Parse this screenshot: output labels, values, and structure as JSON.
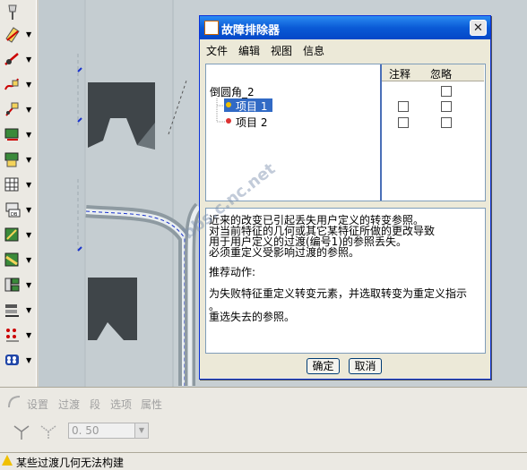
{
  "toolbar": {
    "tools": [
      {
        "icon": "pin-icon"
      },
      {
        "icon": "datum-plane-icon"
      },
      {
        "icon": "datum-axis-icon"
      },
      {
        "icon": "datum-curve-icon"
      },
      {
        "icon": "datum-point-icon"
      },
      {
        "icon": "coordinate-system-icon"
      },
      {
        "icon": "sketch-icon"
      },
      {
        "icon": "grid-icon"
      },
      {
        "icon": "database-icon"
      },
      {
        "icon": "extrude-icon"
      },
      {
        "icon": "revolve-icon"
      },
      {
        "icon": "sweep-icon"
      },
      {
        "icon": "blend-icon"
      },
      {
        "icon": "round-icon"
      },
      {
        "icon": "pattern-icon"
      }
    ]
  },
  "dialog": {
    "title": "故障排除器",
    "close_glyph": "✕",
    "menu": [
      "文件",
      "编辑",
      "视图",
      "信息"
    ],
    "columns": {
      "note": "注释",
      "ignore": "忽略"
    },
    "tree": {
      "root": "倒圆角_2",
      "items": [
        {
          "label": "项目 1",
          "selected": true
        },
        {
          "label": "项目 2",
          "selected": false
        }
      ]
    },
    "message": {
      "lines": [
        "近来的改变已引起丢失用户定义的转变参照。",
        "对当前特征的几何或其它某特征所做的更改导致",
        "用于用户定义的过渡(编号1)的参照丢失。",
        "必须重定义受影响过渡的参照。"
      ],
      "action_heading": "推荐动作:",
      "action_lines": [
        "为失败特征重定义转变元素，并选取转变为重定义指示",
        "。",
        "重选失去的参照。"
      ]
    },
    "ok_label": "确定",
    "cancel_label": "取消"
  },
  "dashboard": {
    "tabs": [
      "设置",
      "过渡",
      "段",
      "选项",
      "属性"
    ],
    "value_field": "0. 50"
  },
  "status": {
    "message": "某些过渡几何无法构建"
  },
  "watermark": "bbs.c.nc.net",
  "colors": {
    "titlebar": "#0a5ad6",
    "model_gray": "#c7cfd3",
    "solid_dark": "#3f4549",
    "selection": "#316ac5"
  }
}
